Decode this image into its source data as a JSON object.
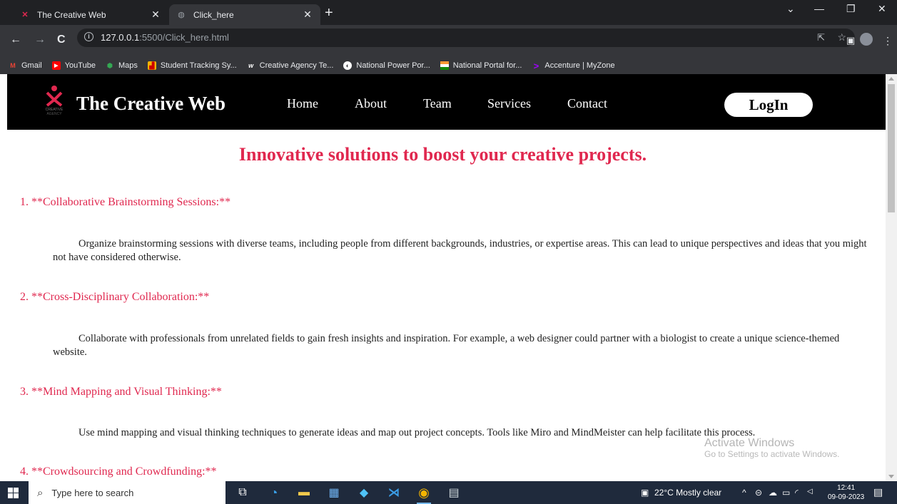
{
  "browser": {
    "tabs": [
      {
        "title": "The Creative Web",
        "favicon": "x-mark-icon"
      },
      {
        "title": "Click_here",
        "favicon": "globe-icon"
      }
    ],
    "new_tab": "+",
    "url_host": "127.0.0.1",
    "url_path": ":5500/Click_here.html",
    "bookmarks": [
      {
        "label": "Gmail",
        "icon": "gmail-icon",
        "color": "#ea4335"
      },
      {
        "label": "YouTube",
        "icon": "youtube-icon",
        "color": "#ff0000"
      },
      {
        "label": "Maps",
        "icon": "maps-icon",
        "color": "#34a853"
      },
      {
        "label": "Student Tracking Sy...",
        "icon": "chart-icon",
        "color": "#f4b400"
      },
      {
        "label": "Creative Agency Te...",
        "icon": "w-icon",
        "color": "#ffffff"
      },
      {
        "label": "National Power Por...",
        "icon": "globe-icon",
        "color": "#ffffff"
      },
      {
        "label": "National Portal for...",
        "icon": "flag-icon",
        "color": "#ff9933"
      },
      {
        "label": "Accenture | MyZone",
        "icon": "accenture-icon",
        "color": "#a100ff"
      }
    ]
  },
  "site": {
    "brand": "The Creative Web",
    "nav": [
      "Home",
      "About",
      "Team",
      "Services",
      "Contact"
    ],
    "login_label": "LogIn",
    "headline": "Innovative solutions to boost your creative projects.",
    "items": [
      {
        "title": "1. **Collaborative Brainstorming Sessions:**",
        "body": "Organize brainstorming sessions with diverse teams, including people from different backgrounds, industries, or expertise areas. This can lead to unique perspectives and ideas that you might not have considered otherwise."
      },
      {
        "title": "2. **Cross-Disciplinary Collaboration:**",
        "body": "Collaborate with professionals from unrelated fields to gain fresh insights and inspiration. For example, a web designer could partner with a biologist to create a unique science-themed website."
      },
      {
        "title": "3. **Mind Mapping and Visual Thinking:**",
        "body": "Use mind mapping and visual thinking techniques to generate ideas and map out project concepts. Tools like Miro and MindMeister can help facilitate this process."
      },
      {
        "title": "4. **Crowdsourcing and Crowdfunding:**",
        "body": ""
      }
    ],
    "accent_color": "#e0284f"
  },
  "watermark": {
    "line1": "Activate Windows",
    "line2": "Go to Settings to activate Windows."
  },
  "taskbar": {
    "search_placeholder": "Type here to search",
    "weather": "22°C  Mostly clear",
    "time": "12:41",
    "date": "09-09-2023"
  }
}
